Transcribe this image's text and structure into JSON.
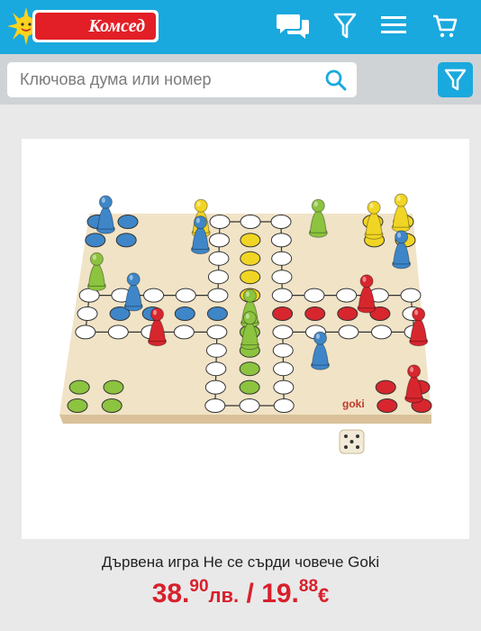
{
  "header": {
    "logo_text": "Комсед",
    "icons": [
      "chat-icon",
      "filter-icon",
      "menu-icon",
      "cart-icon"
    ]
  },
  "search": {
    "placeholder": "Ключова дума или номер",
    "value": ""
  },
  "product": {
    "title": "Дървена игра Не се сърди човече Goki",
    "image_brand_text": "goki",
    "price_bgn_whole": "38.",
    "price_bgn_cents": "90",
    "price_bgn_unit": "лв.",
    "price_separator": " / ",
    "price_eur_whole": "19.",
    "price_eur_cents": "88",
    "price_eur_unit": "€"
  },
  "colors": {
    "brand_blue": "#1aa9de",
    "brand_red": "#e21f26",
    "price_red": "#d8202b"
  }
}
